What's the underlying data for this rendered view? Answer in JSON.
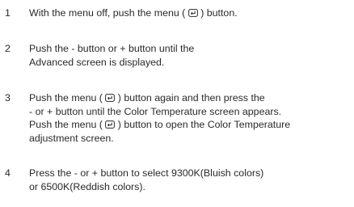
{
  "steps": [
    {
      "number": "1",
      "lines": [
        [
          "With the menu off, push the menu ( ",
          "icon",
          " ) button."
        ]
      ]
    },
    {
      "number": "2",
      "lines": [
        [
          "Push the - button or + button until the"
        ],
        [
          "Advanced screen is displayed."
        ]
      ]
    },
    {
      "number": "3",
      "lines": [
        [
          "Push the menu ( ",
          "icon",
          " ) button again and then press the"
        ],
        [
          "- or + button until the Color Temperature screen appears."
        ],
        [
          "Push the menu ( ",
          "icon",
          " ) button to open the Color Temperature"
        ],
        [
          "adjustment screen."
        ]
      ]
    },
    {
      "number": "4",
      "lines": [
        [
          "Press the - or + button to select 9300K(Bluish colors)"
        ],
        [
          "or 6500K(Reddish colors)."
        ]
      ]
    }
  ],
  "icons": {
    "menu": "menu-enter-icon"
  }
}
